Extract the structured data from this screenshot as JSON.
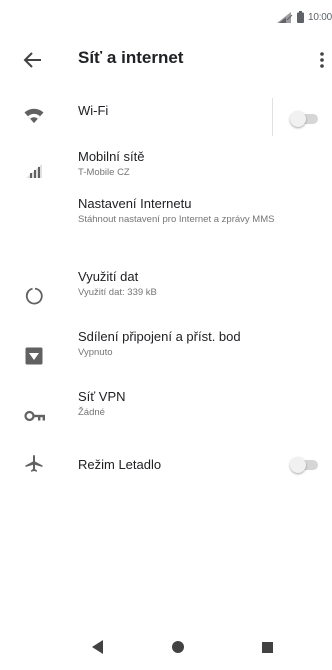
{
  "status_bar": {
    "time": "10:00"
  },
  "app_bar": {
    "title": "Síť a internet"
  },
  "settings": [
    {
      "title": "Wi-Fi",
      "summary": "",
      "icon": "wifi-icon",
      "toggle": true,
      "toggle_on": false
    },
    {
      "title": "Mobilní sítě",
      "summary": "T-Mobile CZ",
      "icon": "signal-icon"
    },
    {
      "title": "Nastavení Internetu",
      "summary": "Stáhnout nastavení pro Internet a zprávy MMS",
      "icon": ""
    },
    {
      "title": "Využití dat",
      "summary": "Využití dat: 339 kB",
      "icon": "data-usage-icon"
    },
    {
      "title": "Sdílení připojení a příst. bod",
      "summary": "Vypnuto",
      "icon": "hotspot-icon"
    },
    {
      "title": "Síť VPN",
      "summary": "Žádné",
      "icon": "vpn-key-icon"
    },
    {
      "title": "Režim Letadlo",
      "summary": "",
      "icon": "airplane-icon",
      "toggle": true,
      "toggle_on": false
    }
  ],
  "colors": {
    "icon": "#616161",
    "text": "#202124",
    "summary": "#757575",
    "toggle_track": "#d6d6d6",
    "toggle_thumb": "#f1f1f1"
  }
}
